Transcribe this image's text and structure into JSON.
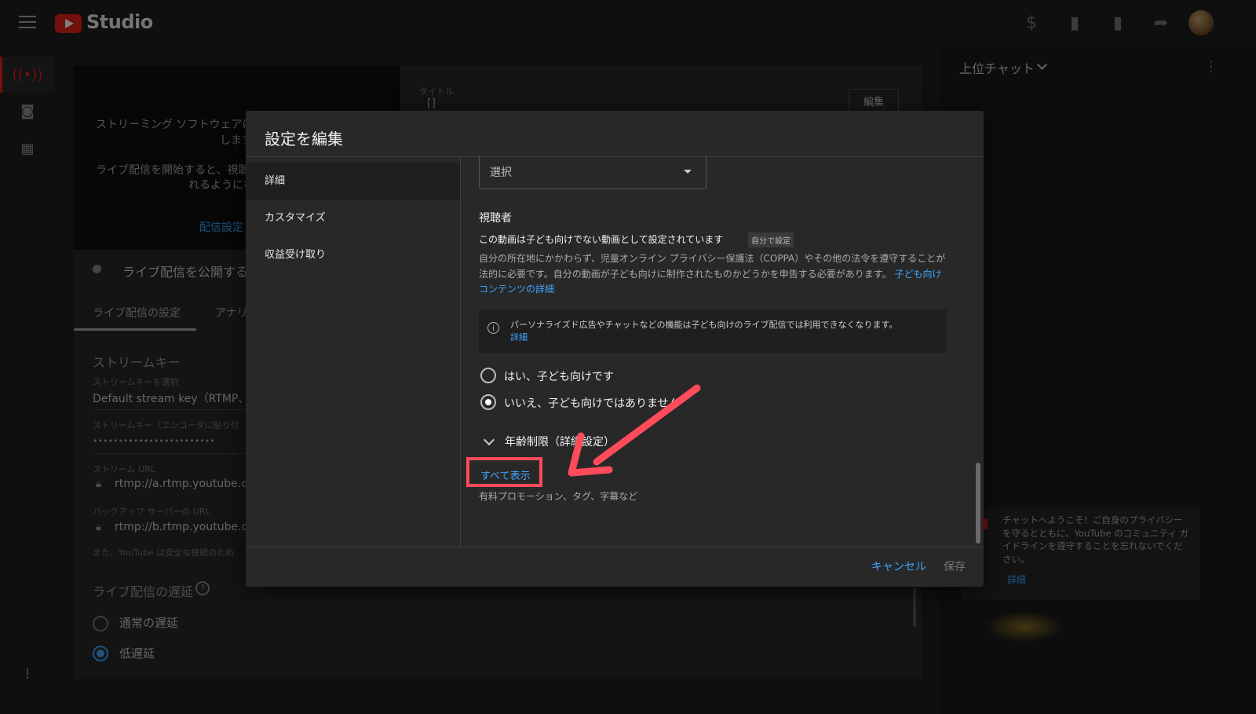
{
  "header": {
    "logo_text": "Studio"
  },
  "background": {
    "preview_text_1": "ストリーミング ソフトウェアに",
    "preview_text_1b": "します",
    "preview_text_2": "ライブ配信を開始すると、視聴",
    "preview_text_2b": "れるようにな",
    "preview_link": "配信設定",
    "publish_text": "ライブ配信を公開する",
    "title_label": "タイトル",
    "edit_button": "編集",
    "tab_live_settings": "ライブ配信の設定",
    "tab_analytics": "アナリ",
    "stream_key_heading": "ストリームキー",
    "stream_key_select_label": "ストリームキーを選択",
    "stream_key_select_value": "Default stream key（RTMP、可",
    "stream_key_field_label": "ストリームキー（エンコーダに貼り付",
    "stream_key_masked": "••••••••••••••••••••••••",
    "stream_url_label": "ストリーム URL",
    "stream_url_value": "rtmp://a.rtmp.youtube.com",
    "backup_url_label": "バックアップ サーバーの URL",
    "backup_url_value": "rtmp://b.rtmp.youtube.com",
    "secure_note": "また、YouTube は安全な接続のため",
    "latency_heading": "ライブ配信の遅延",
    "latency_normal": "通常の遅延",
    "latency_low": "低遅延",
    "chat_heading": "上位チャット",
    "chat_notice": "チャットへようこそ！ご自身のプライバシーを守るとともに、YouTube のコミュニティ ガイドラインを遵守することを忘れないでください。",
    "chat_notice_link": "詳細"
  },
  "modal": {
    "title": "設定を編集",
    "nav": [
      {
        "label": "詳細"
      },
      {
        "label": "カスタマイズ"
      },
      {
        "label": "収益受け取り"
      }
    ],
    "select_placeholder": "選択",
    "audience_heading": "視聴者",
    "audience_status": "この動画は子ども向けでない動画として設定されています",
    "audience_badge": "自分で設定",
    "coppa_desc": "自分の所在地にかかわらず、児童オンライン プライバシー保護法（COPPA）やその他の法令を遵守することが法的に必要です。自分の動画が子ども向けに制作されたものかどうかを申告する必要があります。",
    "coppa_link": "子ども向けコンテンツの詳細",
    "info_text": "パーソナライズド広告やチャットなどの機能は子ども向けのライブ配信では利用できなくなります。",
    "info_link": "詳細",
    "radio_yes": "はい、子ども向けです",
    "radio_no": "いいえ、子ども向けではありません",
    "age_restriction": "年齢制限（詳細設定）",
    "show_all": "すべて表示",
    "show_all_sub": "有料プロモーション、タグ、字幕など",
    "cancel": "キャンセル",
    "save": "保存"
  },
  "colors": {
    "accent": "#3ea6ff",
    "brand_red": "#e62117",
    "highlight": "#ff4b5a"
  }
}
